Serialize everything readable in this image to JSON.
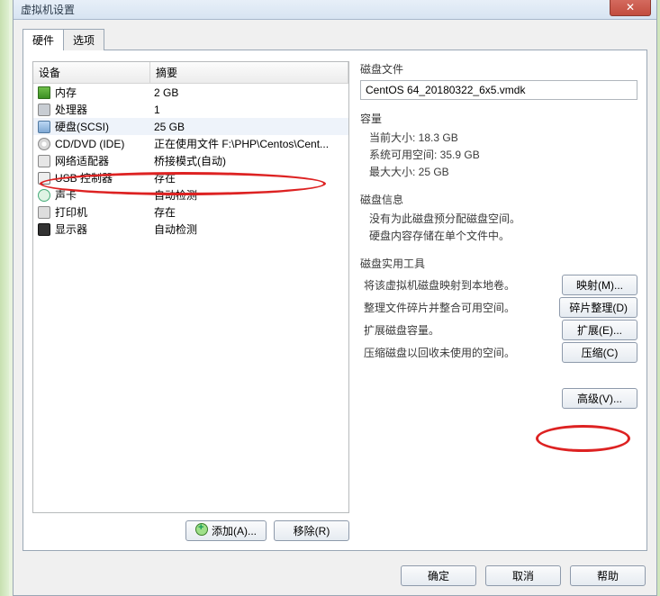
{
  "window": {
    "title": "虚拟机设置"
  },
  "tabs": {
    "hardware": "硬件",
    "options": "选项"
  },
  "list": {
    "headers": {
      "device": "设备",
      "summary": "摘要"
    },
    "rows": [
      {
        "icon": "ic-mem",
        "device": "内存",
        "summary": "2 GB"
      },
      {
        "icon": "ic-cpu",
        "device": "处理器",
        "summary": "1"
      },
      {
        "icon": "ic-hdd",
        "device": "硬盘(SCSI)",
        "summary": "25 GB",
        "selected": true
      },
      {
        "icon": "ic-cd",
        "device": "CD/DVD (IDE)",
        "summary": "正在使用文件 F:\\PHP\\Centos\\Cent..."
      },
      {
        "icon": "ic-net",
        "device": "网络适配器",
        "summary": "桥接模式(自动)"
      },
      {
        "icon": "ic-usb",
        "device": "USB 控制器",
        "summary": "存在"
      },
      {
        "icon": "ic-snd",
        "device": "声卡",
        "summary": "自动检测"
      },
      {
        "icon": "ic-prn",
        "device": "打印机",
        "summary": "存在"
      },
      {
        "icon": "ic-mon",
        "device": "显示器",
        "summary": "自动检测"
      }
    ]
  },
  "left_buttons": {
    "add": "添加(A)...",
    "remove": "移除(R)"
  },
  "right": {
    "disk_file": {
      "title": "磁盘文件",
      "value": "CentOS 64_20180322_6x5.vmdk"
    },
    "capacity": {
      "title": "容量",
      "current": "当前大小: 18.3 GB",
      "sysfree": "系统可用空间: 35.9 GB",
      "max": "最大大小: 25 GB"
    },
    "info": {
      "title": "磁盘信息",
      "line1": "没有为此磁盘预分配磁盘空间。",
      "line2": "硬盘内容存储在单个文件中。"
    },
    "tools": {
      "title": "磁盘实用工具",
      "map": {
        "desc": "将该虚拟机磁盘映射到本地卷。",
        "btn": "映射(M)..."
      },
      "defrag": {
        "desc": "整理文件碎片并整合可用空间。",
        "btn": "碎片整理(D)"
      },
      "expand": {
        "desc": "扩展磁盘容量。",
        "btn": "扩展(E)..."
      },
      "compact": {
        "desc": "压缩磁盘以回收未使用的空间。",
        "btn": "压缩(C)"
      }
    },
    "advanced": "高级(V)..."
  },
  "footer": {
    "ok": "确定",
    "cancel": "取消",
    "help": "帮助"
  }
}
